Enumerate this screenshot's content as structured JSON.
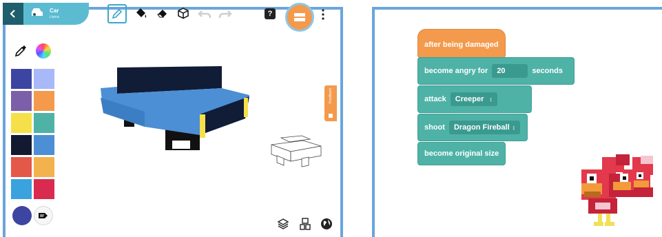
{
  "left_panel": {
    "header": {
      "title": "Car",
      "subtitle": "Llama"
    },
    "help_label": "?",
    "feedback_label": "Feedback",
    "palette": {
      "colors": [
        "#3c45a1",
        "#a8b8f8",
        "#7b5fa8",
        "#f39a4c",
        "#f5e04a",
        "#4fb2a7",
        "#111a30",
        "#4c8fd4",
        "#e4584a",
        "#f2b24e",
        "#3aa3dd",
        "#d92a50"
      ],
      "current": "#3c45a1"
    },
    "toolbar_icons": [
      "back-icon",
      "car-icon",
      "pencil-icon",
      "paint-bucket-icon",
      "eraser-icon",
      "cube-icon",
      "undo-icon",
      "redo-icon",
      "help-icon",
      "publish-icon",
      "more-icon"
    ],
    "bottom_icons": [
      "layers-icon",
      "grid-icon",
      "globe-icon"
    ]
  },
  "right_panel": {
    "blocks": {
      "hat": "after being damaged",
      "angry_prefix": "become angry for",
      "angry_value": "20",
      "angry_suffix": "seconds",
      "attack_label": "attack",
      "attack_value": "Creeper",
      "shoot_label": "shoot",
      "shoot_value": "Dragon Fireball",
      "original_size": "become original size"
    },
    "colors": {
      "event": "#f39a4c",
      "action": "#4fb2a7"
    }
  }
}
